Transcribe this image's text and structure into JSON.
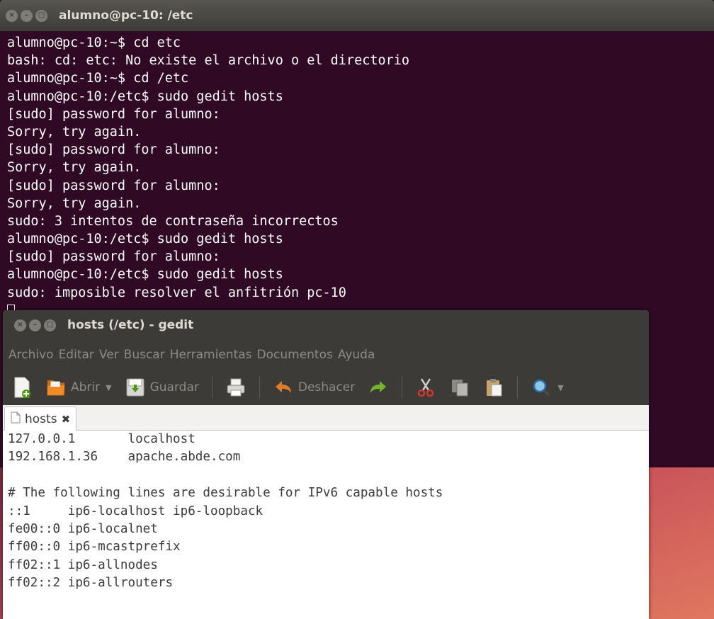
{
  "terminal": {
    "title": "alumno@pc-10: /etc",
    "lines": [
      "alumno@pc-10:~$ cd etc",
      "bash: cd: etc: No existe el archivo o el directorio",
      "alumno@pc-10:~$ cd /etc",
      "alumno@pc-10:/etc$ sudo gedit hosts",
      "[sudo] password for alumno:",
      "Sorry, try again.",
      "[sudo] password for alumno:",
      "Sorry, try again.",
      "[sudo] password for alumno:",
      "Sorry, try again.",
      "sudo: 3 intentos de contraseña incorrectos",
      "alumno@pc-10:/etc$ sudo gedit hosts",
      "[sudo] password for alumno:",
      "alumno@pc-10:/etc$ sudo gedit hosts",
      "sudo: imposible resolver el anfitrión pc-10"
    ]
  },
  "gedit": {
    "title": "hosts (/etc) - gedit",
    "menu": [
      "Archivo",
      "Editar",
      "Ver",
      "Buscar",
      "Herramientas",
      "Documentos",
      "Ayuda"
    ],
    "toolbar": {
      "open_label": "Abrir",
      "save_label": "Guardar",
      "undo_label": "Deshacer"
    },
    "tab": {
      "label": "hosts"
    },
    "document_lines": [
      "127.0.0.1       localhost",
      "192.168.1.36    apache.abde.com",
      "",
      "# The following lines are desirable for IPv6 capable hosts",
      "::1     ip6-localhost ip6-loopback",
      "fe00::0 ip6-localnet",
      "ff00::0 ip6-mcastprefix",
      "ff02::1 ip6-allnodes",
      "ff02::2 ip6-allrouters"
    ]
  },
  "icons": {
    "window_close": "close-icon",
    "window_minimize": "minimize-icon",
    "window_maximize": "maximize-icon",
    "new": "new-document-icon",
    "open": "open-folder-icon",
    "save": "save-icon",
    "print": "print-icon",
    "undo": "undo-icon",
    "redo": "redo-icon",
    "cut": "cut-icon",
    "copy": "copy-icon",
    "paste": "paste-icon",
    "find": "search-icon"
  },
  "colors": {
    "terminal_bg": "#300a24",
    "titlebar": "#3c3b37",
    "editor_bg": "#ffffff"
  }
}
